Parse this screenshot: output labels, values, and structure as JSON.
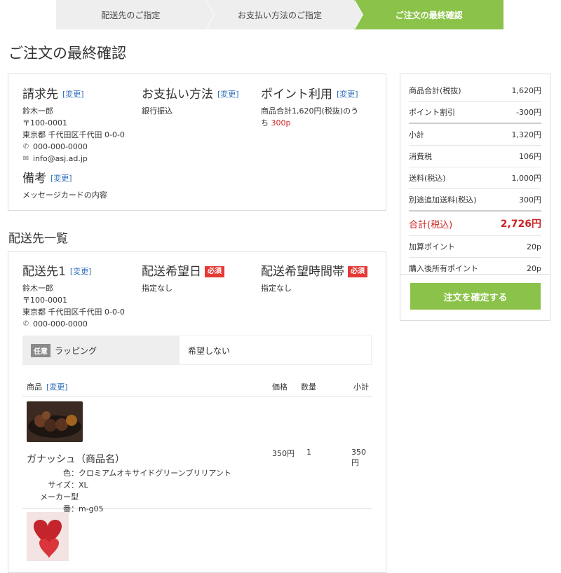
{
  "steps": [
    "配送先のご指定",
    "お支払い方法のご指定",
    "ご注文の最終確認"
  ],
  "page_title": "ご注文の最終確認",
  "change_label": "[変更]",
  "billing": {
    "title": "請求先",
    "name": "鈴木一郎",
    "zip": "〒100-0001",
    "address": "東京都 千代田区千代田 0-0-0",
    "phone": "000-000-0000",
    "email": "info@asj.ad.jp"
  },
  "payment": {
    "title": "お支払い方法",
    "value": "銀行振込"
  },
  "points": {
    "title": "ポイント利用",
    "line1": "商品合計1,620円(税抜)のう",
    "line2_prefix": "ち",
    "amount": "300p"
  },
  "notes": {
    "title": "備考",
    "value": "メッセージカードの内容"
  },
  "delivery_section_title": "配送先一覧",
  "delivery": {
    "title": "配送先1",
    "name": "鈴木一郎",
    "zip": "〒100-0001",
    "address": "東京都 千代田区千代田 0-0-0",
    "phone": "000-000-0000",
    "date_title": "配送希望日",
    "date_value": "指定なし",
    "time_title": "配送希望時間帯",
    "time_value": "指定なし",
    "required": "必須"
  },
  "wrapping": {
    "badge": "任意",
    "label": "ラッピング",
    "value": "希望しない"
  },
  "table": {
    "col_item": "商品",
    "col_change": "[変更]",
    "col_price": "価格",
    "col_qty": "数量",
    "col_subtotal": "小計"
  },
  "items": [
    {
      "name": "ガナッシュ（商品名）",
      "price": "350円",
      "qty": "1",
      "subtotal": "350円",
      "attrs": [
        {
          "k": "色：",
          "v": "クロミアムオキサイドグリーンブリリアント"
        },
        {
          "k": "サイズ：",
          "v": "XL"
        },
        {
          "k": "メーカー型番：",
          "v": "m-g05"
        }
      ]
    }
  ],
  "summary": {
    "rows": [
      {
        "label": "商品合計(税抜)",
        "value": "1,620円"
      },
      {
        "label": "ポイント割引",
        "value": "-300円"
      },
      {
        "label": "小計",
        "value": "1,320円"
      },
      {
        "label": "消費税",
        "value": "106円"
      },
      {
        "label": "送料(税込)",
        "value": "1,000円"
      },
      {
        "label": "別途追加送料(税込)",
        "value": "300円"
      }
    ],
    "total_label": "合計(税込)",
    "total_value": "2,726円",
    "points_earned_label": "加算ポイント",
    "points_earned_value": "20p",
    "points_after_label": "購入後所有ポイント",
    "points_after_value": "20p",
    "confirm_button": "注文を確定する"
  },
  "colors": {
    "accent": "#8bc34a",
    "price_red": "#cc2222",
    "link_blue": "#2f6fbd"
  }
}
